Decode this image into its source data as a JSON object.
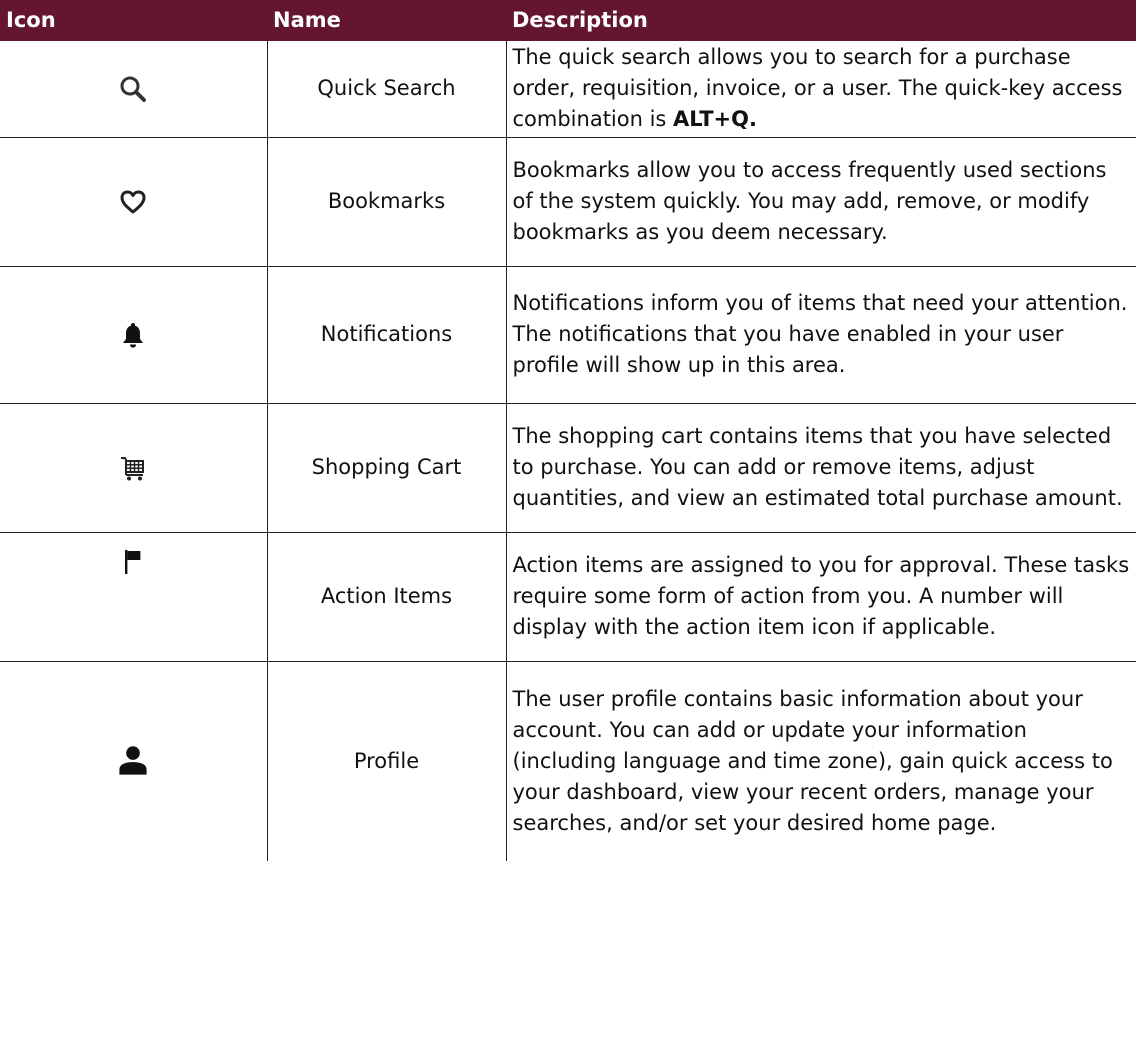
{
  "table": {
    "headers": {
      "icon": "Icon",
      "name": "Name",
      "description": "Description"
    },
    "rows": [
      {
        "icon": "search-icon",
        "name": "Quick Search",
        "description": "The quick search allows you to search for a purchase order, requisition, invoice, or a user. The quick-key access combination is ",
        "description_bold": "ALT+Q."
      },
      {
        "icon": "heart-icon",
        "name": "Bookmarks",
        "description": "Bookmarks allow you to access frequently used sections of the system quickly. You may add, remove, or modify bookmarks as you deem necessary."
      },
      {
        "icon": "bell-icon",
        "name": "Notifications",
        "description": "Notifications inform you of items that need your attention. The notifications that you have enabled in your user profile will show up in this area."
      },
      {
        "icon": "shopping-cart-icon",
        "name": "Shopping Cart",
        "description": "The shopping cart contains items that you have selected to purchase. You can add or remove items, adjust quantities, and view an estimated total purchase amount."
      },
      {
        "icon": "flag-icon",
        "name": "Action Items",
        "description": "Action items are assigned to you for approval. These tasks require some form of action from you. A number will display with the action item icon if applicable."
      },
      {
        "icon": "user-icon",
        "name": "Profile",
        "description": "The user profile contains basic information about your account. You can add or update your information (including language and time zone), gain quick access to your dashboard, view your recent orders, manage your searches, and/or set your desired home page."
      }
    ]
  },
  "colors": {
    "header_bg": "#641532",
    "header_text": "#ffffff",
    "border": "#222222"
  }
}
